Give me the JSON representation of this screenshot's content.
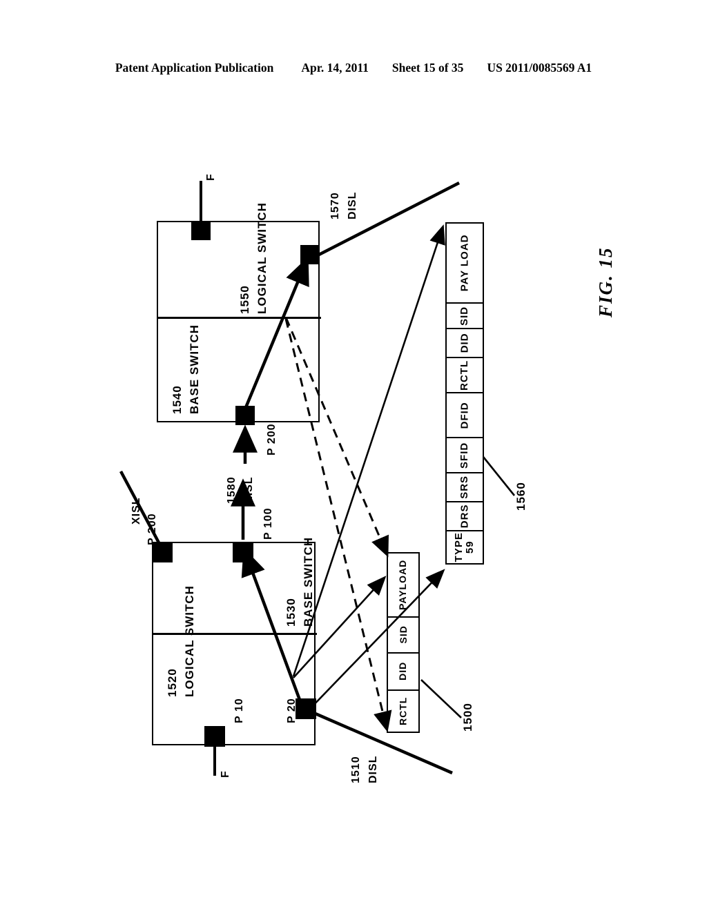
{
  "header": {
    "publication": "Patent Application Publication",
    "date": "Apr. 14, 2011",
    "sheet": "Sheet 15 of 35",
    "number": "US 2011/0085569 A1"
  },
  "figure": {
    "label": "FIG. 15"
  },
  "top_chassis": {
    "base_switch": {
      "ref": "1540",
      "name": "BASE SWITCH"
    },
    "logical_switch": {
      "ref": "1550",
      "name": "LOGICAL SWITCH"
    },
    "ports": [
      {
        "id": "top-chassis-port-f",
        "label": "F"
      },
      {
        "id": "top-chassis-port-p200",
        "label": "P 200"
      },
      {
        "id": "top-chassis-port-disl",
        "label": ""
      }
    ]
  },
  "bottom_chassis": {
    "base_switch": {
      "ref": "1530",
      "name": "BASE SWITCH"
    },
    "logical_switch": {
      "ref": "1520",
      "name": "LOGICAL SWITCH"
    },
    "ports": [
      {
        "id": "bottom-chassis-port-p200",
        "label": "P 200"
      },
      {
        "id": "bottom-chassis-port-p100",
        "label": "P 100"
      },
      {
        "id": "bottom-chassis-port-p10",
        "label": "P 10"
      },
      {
        "id": "bottom-chassis-port-p20",
        "label": "P 20"
      },
      {
        "id": "bottom-chassis-port-f",
        "label": "F"
      }
    ]
  },
  "links": {
    "xisl_top": "XISL",
    "xisl_port": {
      "ref": "1580",
      "name": "XISL"
    },
    "disl_top": {
      "ref": "1570",
      "name": "DISL"
    },
    "disl_bottom": {
      "ref": "1510",
      "name": "DISL"
    }
  },
  "frame_1560": {
    "ref": "1560",
    "fields": [
      "TYPE\n59",
      "DRS",
      "SRS",
      "SFID",
      "DFID",
      "RCTL",
      "DID",
      "SID",
      "PAY LOAD"
    ]
  },
  "frame_1500": {
    "ref": "1500",
    "fields": [
      "RCTL",
      "DID",
      "SID",
      "PAYLOAD"
    ]
  },
  "colors": {
    "ink": "#000000",
    "paper": "#ffffff"
  }
}
